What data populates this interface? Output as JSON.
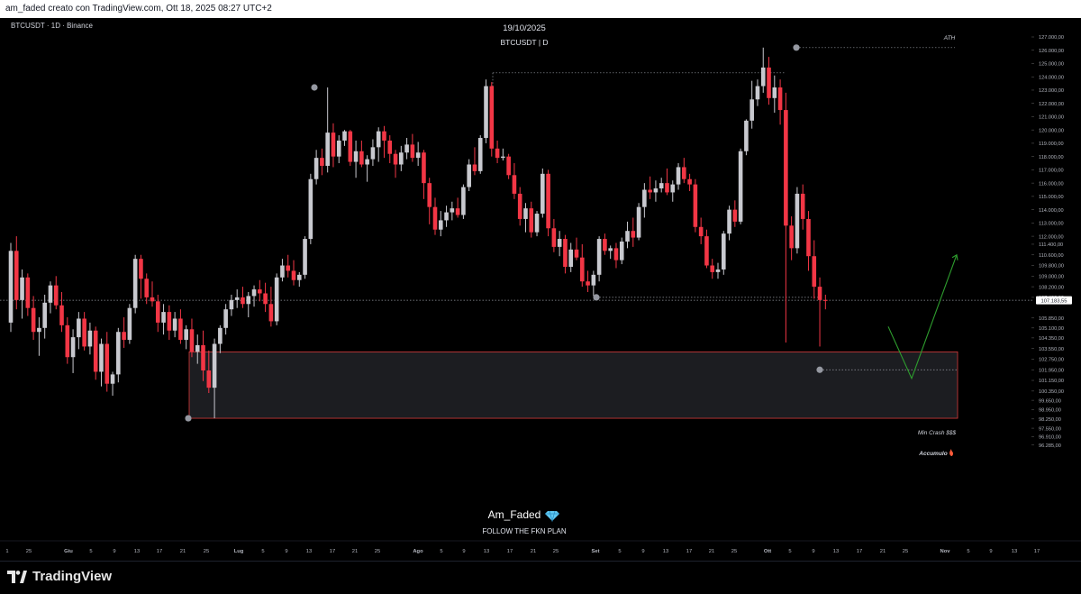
{
  "header": {
    "caption": "am_faded creato con TradingView.com, Ott 18, 2025 08:27 UTC+2"
  },
  "chart_data": {
    "type": "candlestick",
    "symbol_label": "BTCUSDT · 1D · Binance",
    "title_date": "19/10/2025",
    "title_symbol": "BTCUSDT | D",
    "y_ticks": [
      "127.000,00",
      "126.000,00",
      "125.000,00",
      "124.000,00",
      "123.000,00",
      "122.000,00",
      "121.000,00",
      "120.000,00",
      "119.000,00",
      "118.000,00",
      "117.000,00",
      "116.000,00",
      "115.000,00",
      "114.000,00",
      "113.000,00",
      "112.000,00",
      "111.400,00",
      "110.600,00",
      "109.800,00",
      "109.000,00",
      "108.200,00",
      "107.400,00",
      "105.850,00",
      "105.100,00",
      "104.350,00",
      "103.550,00",
      "102.750,00",
      "101.950,00",
      "101.150,00",
      "100.350,00",
      "99.650,00",
      "98.950,00",
      "98.250,00",
      "97.550,00",
      "96.910,00",
      "96.285,00"
    ],
    "last_price_label": "107.183,55",
    "x_ticks": [
      "1",
      "25",
      "Giu",
      "5",
      "9",
      "13",
      "17",
      "21",
      "25",
      "Lug",
      "5",
      "9",
      "13",
      "17",
      "21",
      "25",
      "Ago",
      "5",
      "9",
      "13",
      "17",
      "21",
      "25",
      "Set",
      "5",
      "9",
      "13",
      "17",
      "21",
      "25",
      "Ott",
      "5",
      "9",
      "13",
      "17",
      "21",
      "25",
      "Nov",
      "5",
      "9",
      "13",
      "17"
    ],
    "annotations": {
      "ath": "ATH",
      "min_crash": "Min Crash $$$",
      "accumulo": "Accumulo",
      "watermark_name": "Am_Faded",
      "watermark_tagline": "FOLLOW THE FKN PLAN"
    },
    "candles": [
      [
        105500,
        111500,
        104800,
        110900
      ],
      [
        110900,
        112000,
        106500,
        107200
      ],
      [
        107200,
        109500,
        105800,
        108900
      ],
      [
        108900,
        109200,
        106000,
        106600
      ],
      [
        106600,
        107500,
        104200,
        104800
      ],
      [
        104800,
        105900,
        103000,
        105100
      ],
      [
        105100,
        107600,
        104300,
        107000
      ],
      [
        107000,
        108600,
        106200,
        108300
      ],
      [
        108300,
        109000,
        106500,
        106800
      ],
      [
        106800,
        107800,
        104800,
        105300
      ],
      [
        105300,
        105900,
        102400,
        102900
      ],
      [
        102900,
        105000,
        101700,
        104400
      ],
      [
        104400,
        106300,
        103500,
        105800
      ],
      [
        105800,
        106300,
        103400,
        103700
      ],
      [
        103700,
        105500,
        103100,
        104900
      ],
      [
        104900,
        105200,
        101200,
        101800
      ],
      [
        101800,
        104300,
        100700,
        103900
      ],
      [
        103900,
        104800,
        100300,
        100900
      ],
      [
        100900,
        101800,
        100000,
        101600
      ],
      [
        101600,
        105100,
        101000,
        104800
      ],
      [
        104800,
        105900,
        103600,
        104200
      ],
      [
        104200,
        106900,
        103900,
        106600
      ],
      [
        106600,
        110600,
        106200,
        110300
      ],
      [
        110300,
        110600,
        107300,
        108800
      ],
      [
        108800,
        109200,
        106900,
        107400
      ],
      [
        107400,
        108600,
        106700,
        107100
      ],
      [
        107100,
        107600,
        104800,
        105500
      ],
      [
        105500,
        106900,
        104600,
        106300
      ],
      [
        106300,
        106800,
        104200,
        104900
      ],
      [
        104900,
        106300,
        104400,
        105800
      ],
      [
        105800,
        106500,
        103900,
        104200
      ],
      [
        104200,
        105300,
        103500,
        105000
      ],
      [
        105000,
        105800,
        102900,
        103300
      ],
      [
        103300,
        104600,
        102400,
        103800
      ],
      [
        103800,
        104900,
        101100,
        101900
      ],
      [
        101900,
        103400,
        100200,
        100600
      ],
      [
        100600,
        104300,
        98300,
        103900
      ],
      [
        103900,
        105300,
        103200,
        105100
      ],
      [
        105100,
        106900,
        104600,
        106500
      ],
      [
        106500,
        107600,
        106000,
        107200
      ],
      [
        107200,
        108000,
        106600,
        107400
      ],
      [
        107400,
        108200,
        106600,
        106900
      ],
      [
        106900,
        107800,
        105900,
        107500
      ],
      [
        107500,
        108300,
        106700,
        108000
      ],
      [
        108000,
        108700,
        107100,
        107700
      ],
      [
        107700,
        108500,
        106300,
        106900
      ],
      [
        106900,
        108200,
        105200,
        105600
      ],
      [
        105600,
        109200,
        105300,
        108900
      ],
      [
        108900,
        110300,
        108600,
        109800
      ],
      [
        109800,
        110600,
        108900,
        109400
      ],
      [
        109400,
        110200,
        108300,
        108700
      ],
      [
        108700,
        109300,
        108200,
        109100
      ],
      [
        109100,
        112000,
        108800,
        111800
      ],
      [
        111800,
        116700,
        111400,
        116300
      ],
      [
        116300,
        118500,
        115900,
        117900
      ],
      [
        117900,
        118600,
        116600,
        117300
      ],
      [
        117300,
        123200,
        116800,
        119800
      ],
      [
        119800,
        120500,
        117200,
        118000
      ],
      [
        118000,
        119600,
        117500,
        119200
      ],
      [
        119200,
        120000,
        118800,
        119900
      ],
      [
        119900,
        120000,
        117300,
        117600
      ],
      [
        117600,
        119200,
        116400,
        118400
      ],
      [
        118400,
        119200,
        117200,
        117400
      ],
      [
        117400,
        118100,
        116100,
        117800
      ],
      [
        117800,
        119300,
        117300,
        118700
      ],
      [
        118700,
        120200,
        117600,
        119900
      ],
      [
        119900,
        120300,
        117900,
        119200
      ],
      [
        119200,
        119600,
        117500,
        118200
      ],
      [
        118200,
        118500,
        116400,
        117400
      ],
      [
        117400,
        118800,
        116900,
        118300
      ],
      [
        118300,
        119400,
        117800,
        118900
      ],
      [
        118900,
        119700,
        117600,
        117900
      ],
      [
        117900,
        119100,
        117300,
        118300
      ],
      [
        118300,
        118500,
        114800,
        116000
      ],
      [
        116000,
        116400,
        112900,
        114200
      ],
      [
        114200,
        114900,
        112100,
        112500
      ],
      [
        112500,
        113900,
        112000,
        113200
      ],
      [
        113200,
        114300,
        112700,
        113800
      ],
      [
        113800,
        114600,
        113200,
        114100
      ],
      [
        114100,
        114900,
        113400,
        113600
      ],
      [
        113600,
        115900,
        113300,
        115700
      ],
      [
        115700,
        117800,
        115400,
        117400
      ],
      [
        117400,
        118700,
        116600,
        116900
      ],
      [
        116900,
        119600,
        116700,
        119400
      ],
      [
        119400,
        123800,
        119000,
        123300
      ],
      [
        123300,
        123600,
        118000,
        118600
      ],
      [
        118600,
        119200,
        117500,
        117900
      ],
      [
        117900,
        118600,
        117700,
        118000
      ],
      [
        118000,
        118200,
        116300,
        116600
      ],
      [
        116600,
        117500,
        114800,
        115200
      ],
      [
        115200,
        115700,
        112800,
        113300
      ],
      [
        113300,
        114500,
        112300,
        114100
      ],
      [
        114100,
        114600,
        111900,
        112300
      ],
      [
        112300,
        113900,
        112000,
        113700
      ],
      [
        113700,
        117100,
        113400,
        116700
      ],
      [
        116700,
        117000,
        112000,
        112600
      ],
      [
        112600,
        113300,
        110800,
        111200
      ],
      [
        111200,
        112400,
        110500,
        111800
      ],
      [
        111800,
        112100,
        109200,
        109700
      ],
      [
        109700,
        111500,
        109300,
        111000
      ],
      [
        111000,
        111900,
        110200,
        110400
      ],
      [
        110400,
        111400,
        108200,
        108600
      ],
      [
        108600,
        109400,
        107800,
        108300
      ],
      [
        108300,
        109400,
        107500,
        109100
      ],
      [
        109100,
        112000,
        108600,
        111800
      ],
      [
        111800,
        112200,
        110600,
        110900
      ],
      [
        110900,
        111300,
        110300,
        111100
      ],
      [
        111100,
        111500,
        109600,
        110200
      ],
      [
        110200,
        111900,
        109900,
        111600
      ],
      [
        111600,
        113100,
        111100,
        112400
      ],
      [
        112400,
        113400,
        111200,
        111900
      ],
      [
        111900,
        114500,
        111700,
        114200
      ],
      [
        114200,
        116000,
        113400,
        115500
      ],
      [
        115500,
        116500,
        114800,
        115300
      ],
      [
        115300,
        116200,
        114600,
        115600
      ],
      [
        115600,
        116400,
        115300,
        116000
      ],
      [
        116000,
        117100,
        115100,
        115300
      ],
      [
        115300,
        116200,
        114600,
        115900
      ],
      [
        115900,
        117500,
        115500,
        117200
      ],
      [
        117200,
        117900,
        116000,
        116300
      ],
      [
        116300,
        116700,
        115400,
        115900
      ],
      [
        115900,
        116300,
        112300,
        112700
      ],
      [
        112700,
        113400,
        111400,
        112000
      ],
      [
        112000,
        112500,
        109600,
        109800
      ],
      [
        109800,
        110300,
        108800,
        109300
      ],
      [
        109300,
        110000,
        108800,
        109500
      ],
      [
        109500,
        112400,
        109100,
        112200
      ],
      [
        112200,
        114300,
        111700,
        114000
      ],
      [
        114000,
        114700,
        112700,
        113100
      ],
      [
        113100,
        118600,
        112900,
        118400
      ],
      [
        118400,
        120800,
        118100,
        120700
      ],
      [
        120700,
        123700,
        120100,
        122300
      ],
      [
        122300,
        123800,
        121800,
        123300
      ],
      [
        123300,
        126200,
        122800,
        124700
      ],
      [
        124700,
        125500,
        121900,
        122400
      ],
      [
        122400,
        124100,
        121300,
        123200
      ],
      [
        123200,
        123800,
        120400,
        121500
      ],
      [
        121500,
        122800,
        104000,
        112800
      ],
      [
        112800,
        113500,
        110200,
        111100
      ],
      [
        111100,
        115700,
        110700,
        115200
      ],
      [
        115200,
        115900,
        112500,
        113300
      ],
      [
        113300,
        113900,
        109400,
        110500
      ],
      [
        110500,
        111700,
        107300,
        108200
      ],
      [
        108200,
        108900,
        103700,
        107200
      ],
      [
        107200,
        107600,
        106500,
        107183
      ]
    ]
  }
}
